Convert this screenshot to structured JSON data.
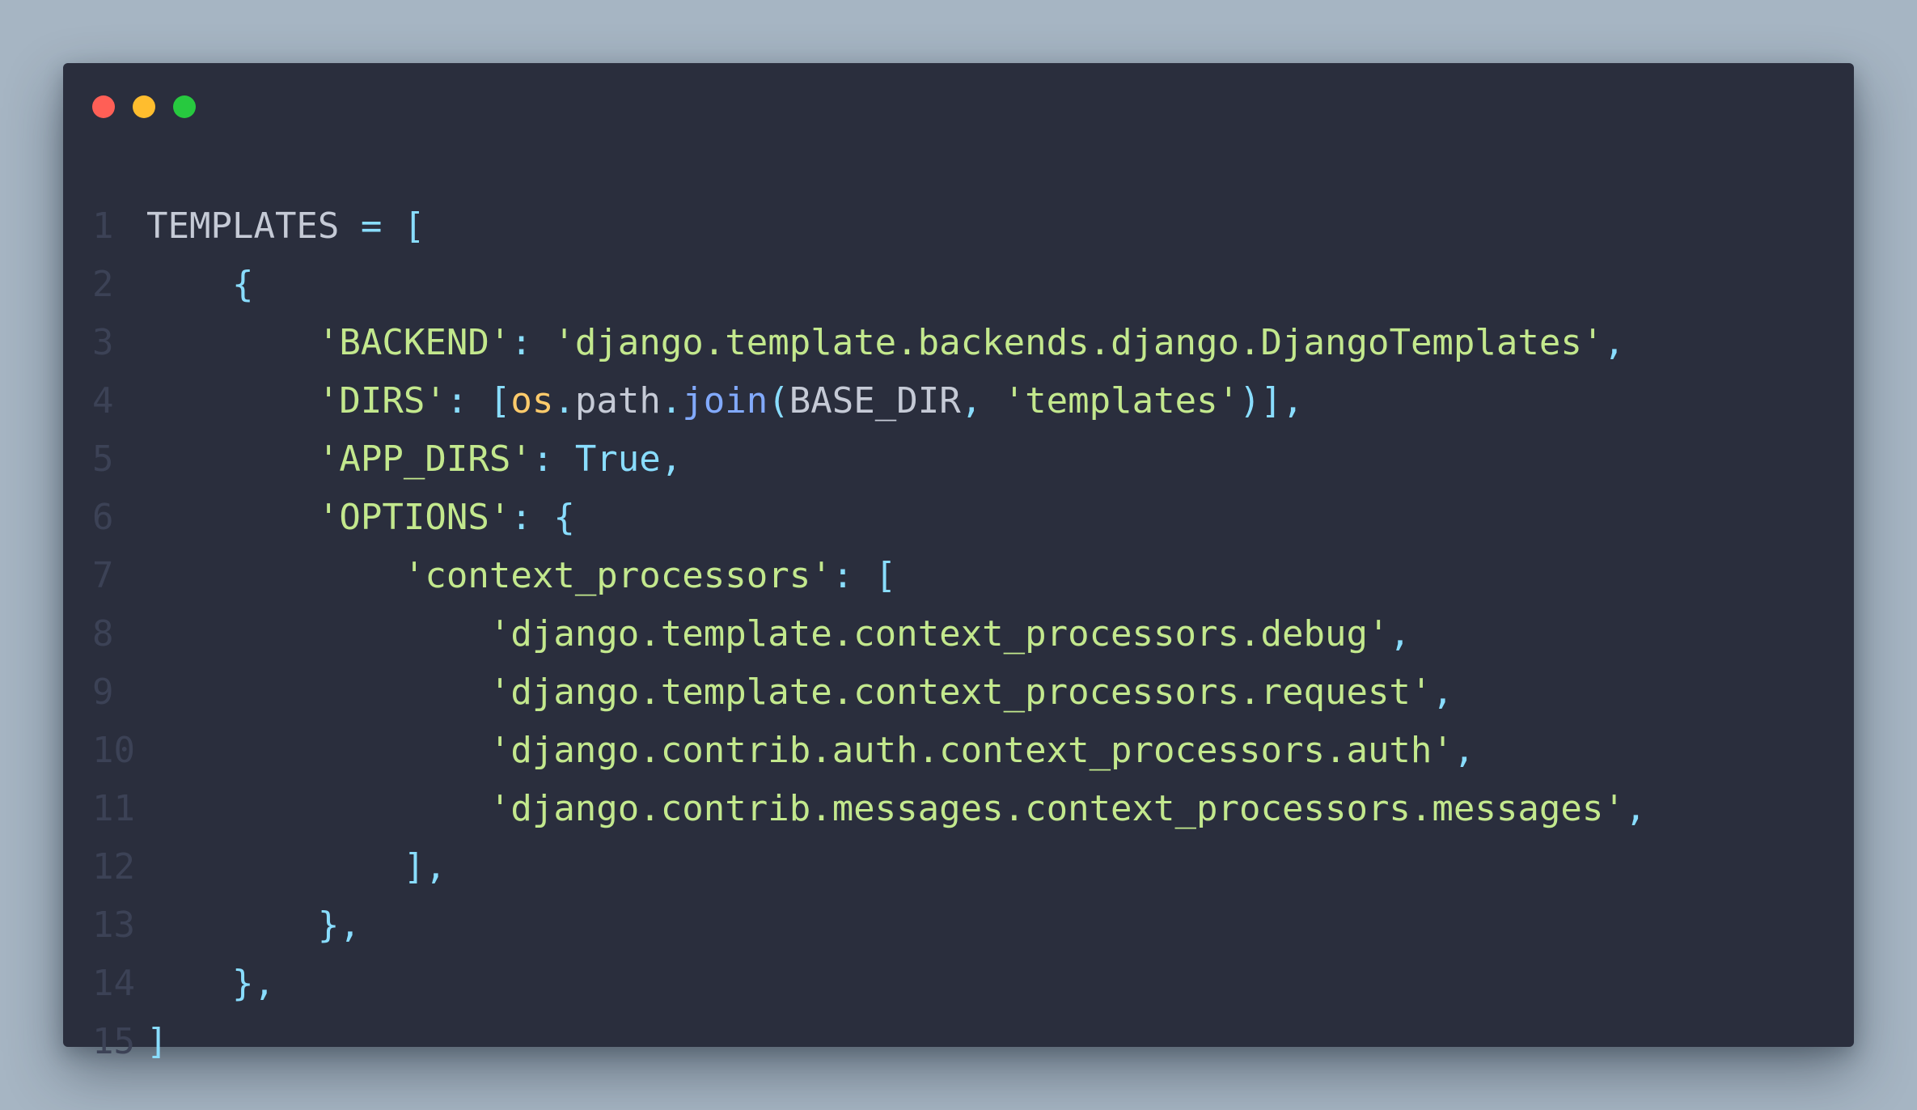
{
  "window": {
    "buttons": [
      {
        "name": "close",
        "color": "#ff5f56"
      },
      {
        "name": "minimize",
        "color": "#ffbd2e"
      },
      {
        "name": "maximize",
        "color": "#27c93f"
      }
    ]
  },
  "theme": {
    "background": "#a6b5c3",
    "window_bg": "#2a2e3d",
    "string": "#c3e88d",
    "punctuation": "#89ddff",
    "plain": "#c5cad6",
    "module": "#ffcb6b",
    "function": "#82aaff",
    "line_number": "#3c4256"
  },
  "code": {
    "lines": [
      {
        "n": "1",
        "tokens": [
          [
            "plain",
            "TEMPLATES "
          ],
          [
            "punc",
            "= ["
          ]
        ]
      },
      {
        "n": "2",
        "tokens": [
          [
            "plain",
            "    "
          ],
          [
            "punc",
            "{"
          ]
        ]
      },
      {
        "n": "3",
        "tokens": [
          [
            "plain",
            "        "
          ],
          [
            "str",
            "'BACKEND'"
          ],
          [
            "punc",
            ": "
          ],
          [
            "str",
            "'django.template.backends.django.DjangoTemplates'"
          ],
          [
            "punc",
            ","
          ]
        ]
      },
      {
        "n": "4",
        "tokens": [
          [
            "plain",
            "        "
          ],
          [
            "str",
            "'DIRS'"
          ],
          [
            "punc",
            ": ["
          ],
          [
            "mod",
            "os"
          ],
          [
            "punc",
            "."
          ],
          [
            "plain",
            "path"
          ],
          [
            "punc",
            "."
          ],
          [
            "fn",
            "join"
          ],
          [
            "punc",
            "("
          ],
          [
            "plain",
            "BASE_DIR"
          ],
          [
            "punc",
            ", "
          ],
          [
            "str",
            "'templates'"
          ],
          [
            "punc",
            ")],"
          ]
        ]
      },
      {
        "n": "5",
        "tokens": [
          [
            "plain",
            "        "
          ],
          [
            "str",
            "'APP_DIRS'"
          ],
          [
            "punc",
            ": "
          ],
          [
            "bool",
            "True"
          ],
          [
            "punc",
            ","
          ]
        ]
      },
      {
        "n": "6",
        "tokens": [
          [
            "plain",
            "        "
          ],
          [
            "str",
            "'OPTIONS'"
          ],
          [
            "punc",
            ": {"
          ]
        ]
      },
      {
        "n": "7",
        "tokens": [
          [
            "plain",
            "            "
          ],
          [
            "str",
            "'context_processors'"
          ],
          [
            "punc",
            ": ["
          ]
        ]
      },
      {
        "n": "8",
        "tokens": [
          [
            "plain",
            "                "
          ],
          [
            "str",
            "'django.template.context_processors.debug'"
          ],
          [
            "punc",
            ","
          ]
        ]
      },
      {
        "n": "9",
        "tokens": [
          [
            "plain",
            "                "
          ],
          [
            "str",
            "'django.template.context_processors.request'"
          ],
          [
            "punc",
            ","
          ]
        ]
      },
      {
        "n": "10",
        "tokens": [
          [
            "plain",
            "                "
          ],
          [
            "str",
            "'django.contrib.auth.context_processors.auth'"
          ],
          [
            "punc",
            ","
          ]
        ]
      },
      {
        "n": "11",
        "tokens": [
          [
            "plain",
            "                "
          ],
          [
            "str",
            "'django.contrib.messages.context_processors.messages'"
          ],
          [
            "punc",
            ","
          ]
        ]
      },
      {
        "n": "12",
        "tokens": [
          [
            "plain",
            "            "
          ],
          [
            "punc",
            "],"
          ]
        ]
      },
      {
        "n": "13",
        "tokens": [
          [
            "plain",
            "        "
          ],
          [
            "punc",
            "},"
          ]
        ]
      },
      {
        "n": "14",
        "tokens": [
          [
            "plain",
            "    "
          ],
          [
            "punc",
            "},"
          ]
        ]
      },
      {
        "n": "15",
        "tokens": [
          [
            "punc",
            "]"
          ]
        ]
      }
    ]
  }
}
